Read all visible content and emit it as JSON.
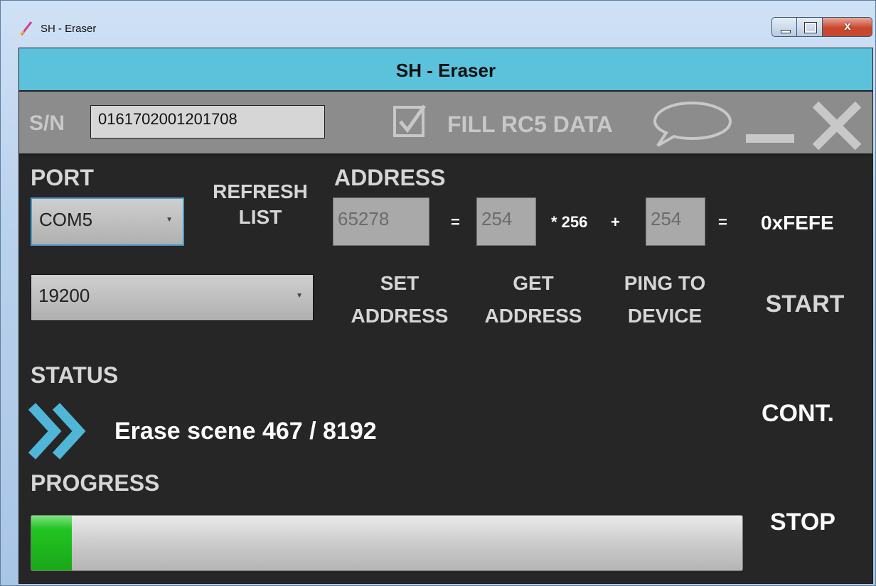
{
  "window": {
    "title": "SH - Eraser",
    "controls": {
      "minimize_icon": "minimize-icon",
      "maximize_icon": "maximize-icon",
      "close_glyph": "x"
    }
  },
  "header": {
    "title": "SH - Eraser"
  },
  "toolbar": {
    "sn_label": "S/N",
    "sn_value": "0161702001201708",
    "fill_checked": true,
    "fill_label": "FILL RC5 DATA",
    "icons": [
      "chat-bubble-icon",
      "minimize-icon",
      "close-icon"
    ]
  },
  "port": {
    "label": "PORT",
    "selected": "COM5",
    "baud_selected": "19200",
    "refresh_line1": "REFRESH",
    "refresh_line2": "LIST"
  },
  "address": {
    "label": "ADDRESS",
    "decimal": "65278",
    "eq1": "=",
    "high_byte": "254",
    "mult": "* 256",
    "plus": "+",
    "low_byte": "254",
    "eq2": "=",
    "hex": "0xFEFE"
  },
  "actions": {
    "set_line1": "SET",
    "set_line2": "ADDRESS",
    "get_line1": "GET",
    "get_line2": "ADDRESS",
    "ping_line1": "PING TO",
    "ping_line2": "DEVICE",
    "start": "START",
    "cont": "CONT.",
    "stop": "STOP"
  },
  "status": {
    "label": "STATUS",
    "text": "Erase scene 467 / 8192",
    "icon": "double-chevron-right-icon"
  },
  "progress": {
    "label": "PROGRESS",
    "fraction": 0.057
  },
  "colors": {
    "header_bg": "#5cc2dc",
    "toolbar_bg": "#8c8c8c",
    "panel_bg": "#262626",
    "chevron": "#4fb6d8",
    "progress_fill": "#22c322"
  }
}
